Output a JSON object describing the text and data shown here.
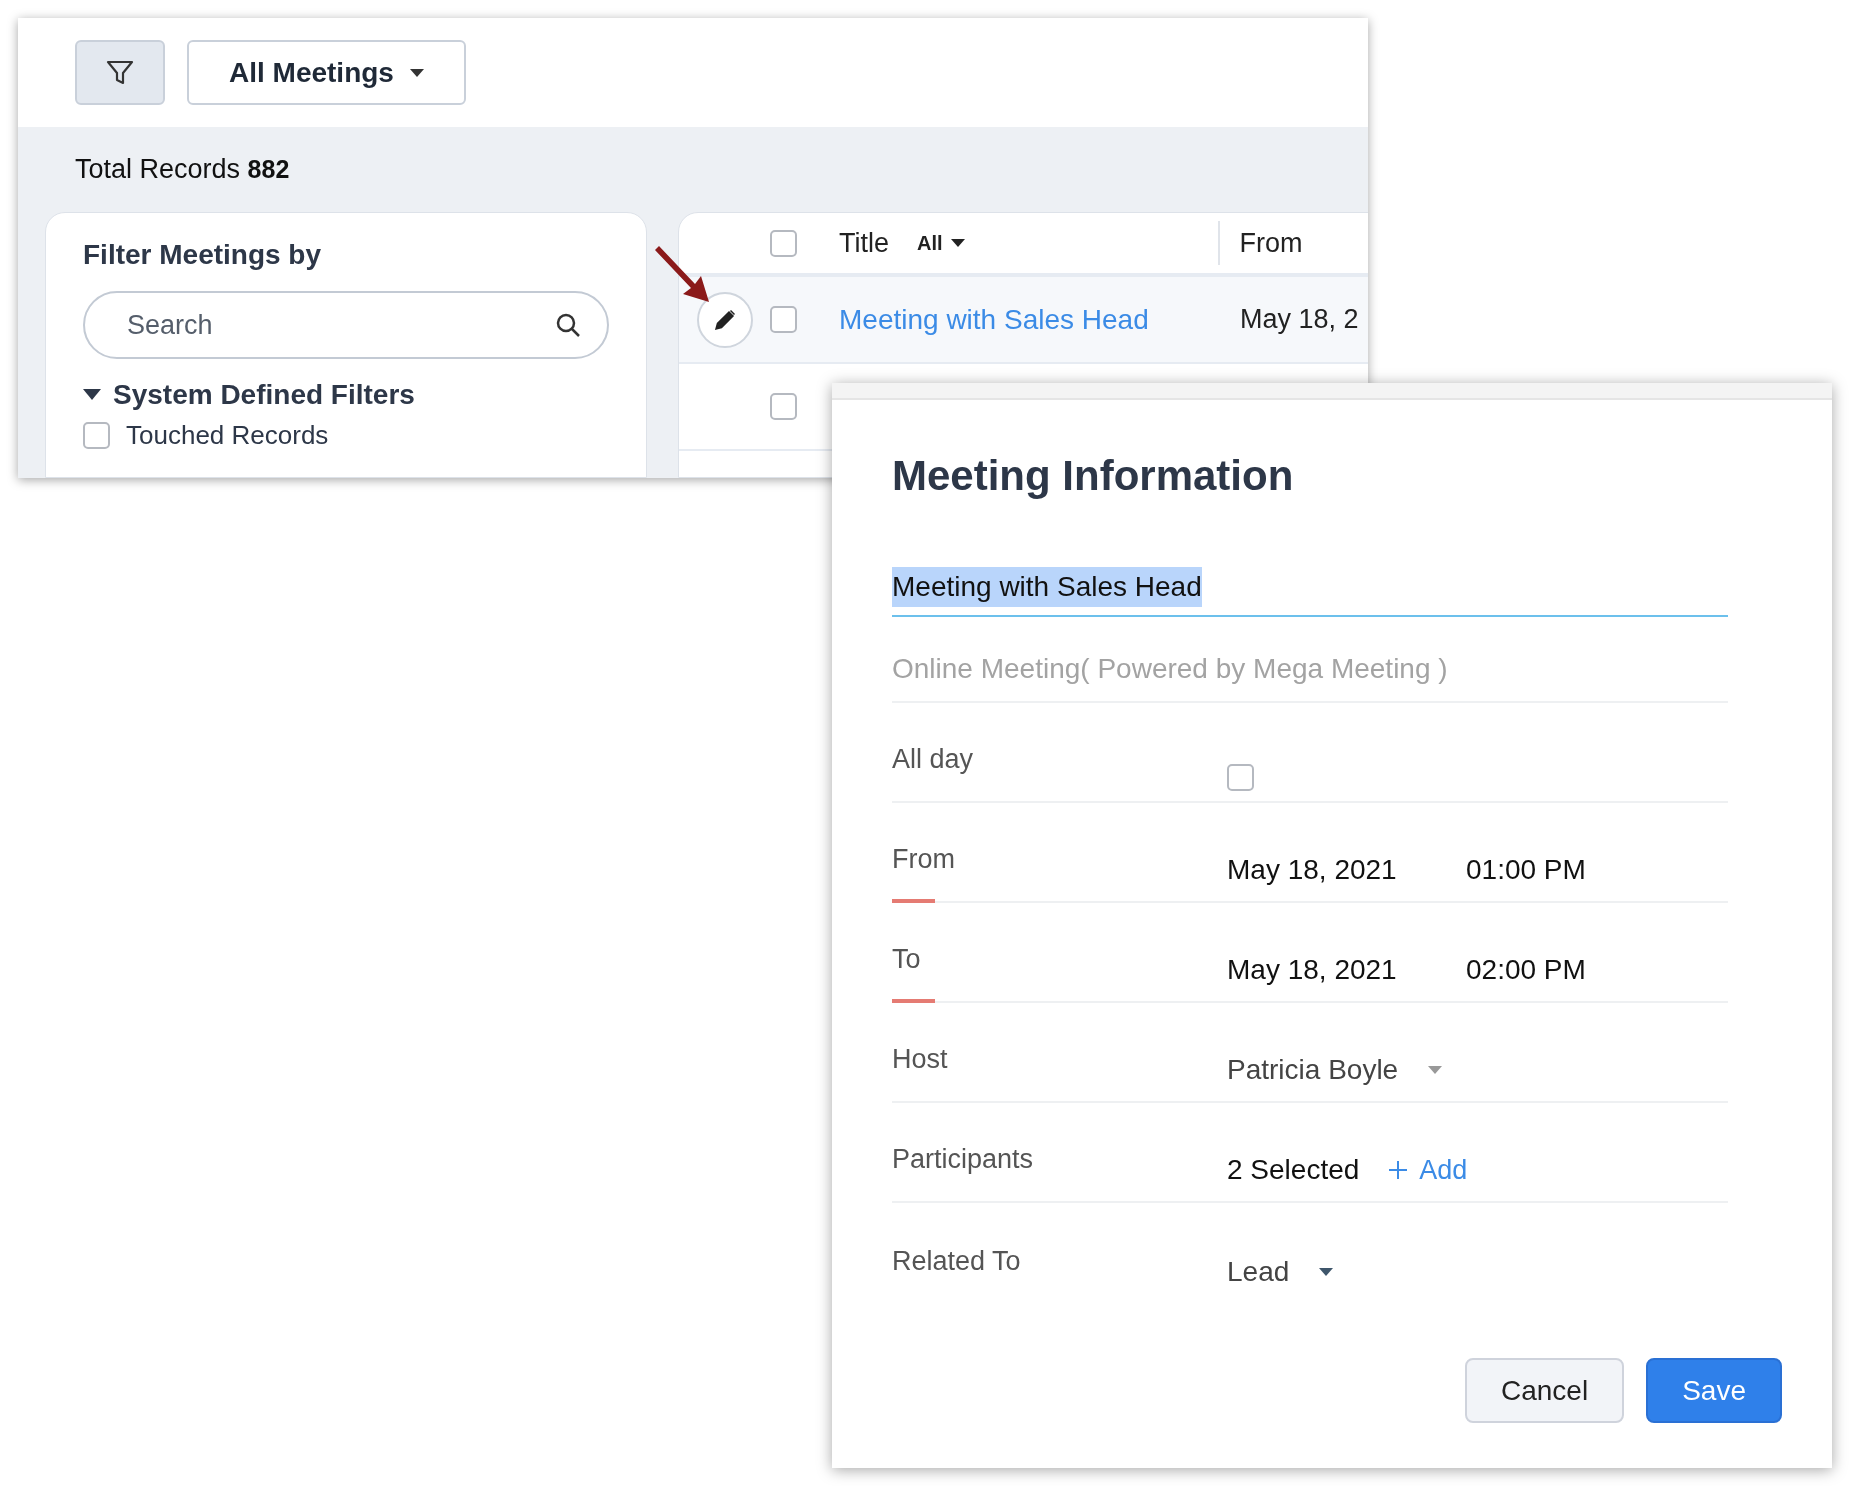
{
  "list_view": {
    "view_selector": {
      "label": "All Meetings"
    },
    "total_records": {
      "label": "Total Records",
      "count": "882"
    },
    "filter_panel": {
      "title": "Filter Meetings by",
      "search": {
        "placeholder": "Search"
      },
      "section": {
        "label": "System Defined Filters",
        "expanded": true,
        "items": [
          {
            "label": "Touched Records",
            "checked": false
          }
        ]
      }
    },
    "table": {
      "select_all_checked": false,
      "columns": [
        {
          "label": "Title",
          "filter": "All"
        },
        {
          "label": "From"
        }
      ],
      "rows": [
        {
          "title": "Meeting with Sales Head",
          "from": "May 18, 2",
          "checked": false,
          "hovered": true
        },
        {
          "checked": false,
          "hovered": false
        }
      ]
    }
  },
  "dialog": {
    "title": "Meeting Information",
    "meeting_title": {
      "value": "Meeting with Sales Head",
      "highlighted": true
    },
    "online_meeting": {
      "placeholder": "Online Meeting( Powered by Mega Meeting )"
    },
    "fields": [
      {
        "kind": "checkbox",
        "label": "All day",
        "checked": false
      },
      {
        "kind": "datetime",
        "label": "From",
        "date": "May 18, 2021",
        "time": "01:00 PM",
        "required": true
      },
      {
        "kind": "datetime",
        "label": "To",
        "date": "May 18, 2021",
        "time": "02:00 PM",
        "required": true
      },
      {
        "kind": "dropdown",
        "label": "Host",
        "value": "Patricia Boyle"
      },
      {
        "kind": "participants",
        "label": "Participants",
        "value": "2 Selected",
        "add_label": "Add"
      },
      {
        "kind": "dropdown",
        "label": "Related To",
        "value": "Lead"
      }
    ],
    "buttons": [
      {
        "label": "Cancel",
        "kind": "secondary"
      },
      {
        "label": "Save",
        "kind": "primary"
      }
    ]
  }
}
